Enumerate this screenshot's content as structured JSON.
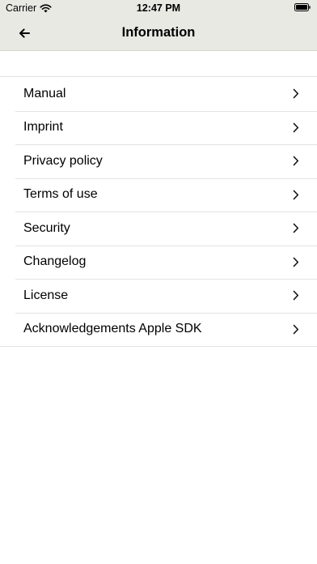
{
  "status_bar": {
    "carrier": "Carrier",
    "time": "12:47 PM",
    "icons": [
      "wifi-icon",
      "battery-icon"
    ]
  },
  "nav": {
    "back_icon": "arrow-left-icon",
    "title": "Information"
  },
  "menu": {
    "items": [
      {
        "label": "Manual"
      },
      {
        "label": "Imprint"
      },
      {
        "label": "Privacy policy"
      },
      {
        "label": "Terms of use"
      },
      {
        "label": "Security"
      },
      {
        "label": "Changelog"
      },
      {
        "label": "License"
      },
      {
        "label": "Acknowledgements Apple SDK"
      }
    ],
    "chevron_icon": "chevron-right-icon"
  },
  "colors": {
    "bar_background": "#e9e9e4",
    "separator": "#e3e3e3"
  }
}
